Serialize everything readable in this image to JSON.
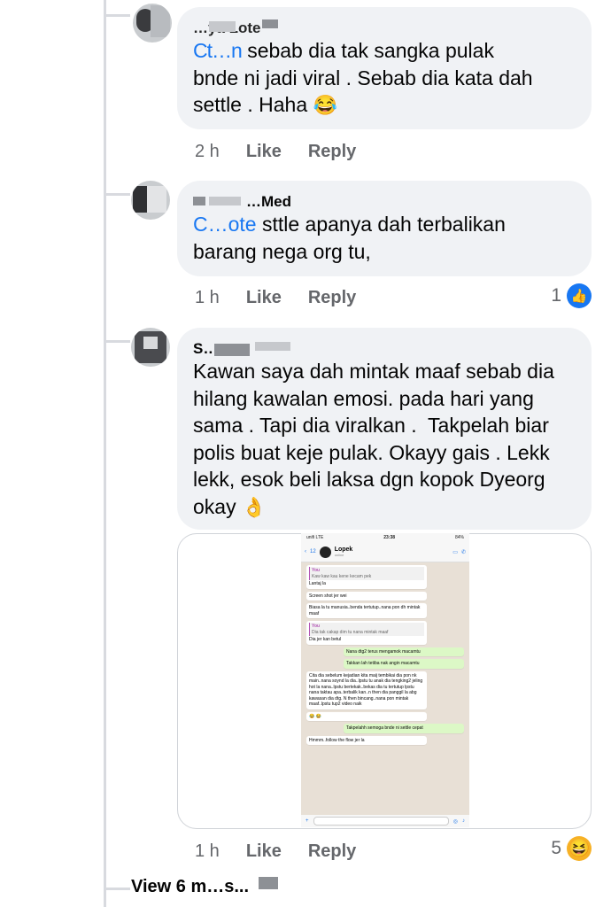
{
  "comments": [
    {
      "author": "…ya Lote",
      "tag": "Ct…n",
      "text": "sebab dia tak sangka pulak\nbnde ni jadi viral . Sebab dia kata dah\nsettle . Haha",
      "emoji": "😂",
      "time": "2 h",
      "like_label": "Like",
      "reply_label": "Reply",
      "reaction_count": ""
    },
    {
      "author": "…Med",
      "tag": "C…ote",
      "text": "sttle apanya dah terbalikan\nbarang nega org tu,",
      "time": "1 h",
      "like_label": "Like",
      "reply_label": "Reply",
      "reaction_count": "1"
    },
    {
      "author": "S…",
      "text": "Kawan saya dah mintak maaf sebab dia\nhilang kawalan emosi. pada hari yang\nsama . Tapi dia viralkan .  Takpelah biar\npolis buat keje pulak. Okayy gais . Lekk\nlekk, esok beli laksa dgn kopok Dyeorg\nokay",
      "emoji": "👌",
      "time": "1 h",
      "like_label": "Like",
      "reply_label": "Reply",
      "reaction_count": "5"
    }
  ],
  "attachment": {
    "status_left": "unifi LTE",
    "status_time": "23:38",
    "status_right": "84%",
    "back_count": "12",
    "contact_name": "Lopek",
    "contact_status": "online",
    "messages": [
      {
        "dir": "in",
        "quote_name": "You",
        "quote": "Kaw kaw kau kene kecam pek",
        "text": "Lantaj la"
      },
      {
        "dir": "in",
        "text": "Screen shot jer wei"
      },
      {
        "dir": "in",
        "text": "Biasa la tu manusia..benda tertutup..nana pon dh mintak maaf"
      },
      {
        "dir": "in",
        "quote_name": "You",
        "quote": "Dia tak cakap dim tu nana mintak maaf",
        "text": "Dia jer kan betul"
      },
      {
        "dir": "out",
        "text": "Nana dtg2 terus mengamok macamtu"
      },
      {
        "dir": "out",
        "text": "Takkan lah tetiba nak angin macamtu"
      },
      {
        "dir": "in",
        "text": "Cita dia sebelum kejadian kita maij tembikai dia pon nk main..nana soynd la dia..lpstu tu anak dia tengking2 jeling hot la nana..lpstu bertekak..bekas dia tu tertutup lpstu nana taktau apa..terbalik kan..n then dia panggil la abg kawasan dia dtg. N then bincang..nana pon mintak maaf..lpstu tup2 video naik"
      },
      {
        "dir": "in",
        "text": "😂 😂"
      },
      {
        "dir": "out",
        "text": "Takpelahh semoga bnde ni settle cepat"
      },
      {
        "dir": "in",
        "text": "Hmmm..follow the flow jer la"
      }
    ]
  },
  "view_more": "View 6 m…s..."
}
